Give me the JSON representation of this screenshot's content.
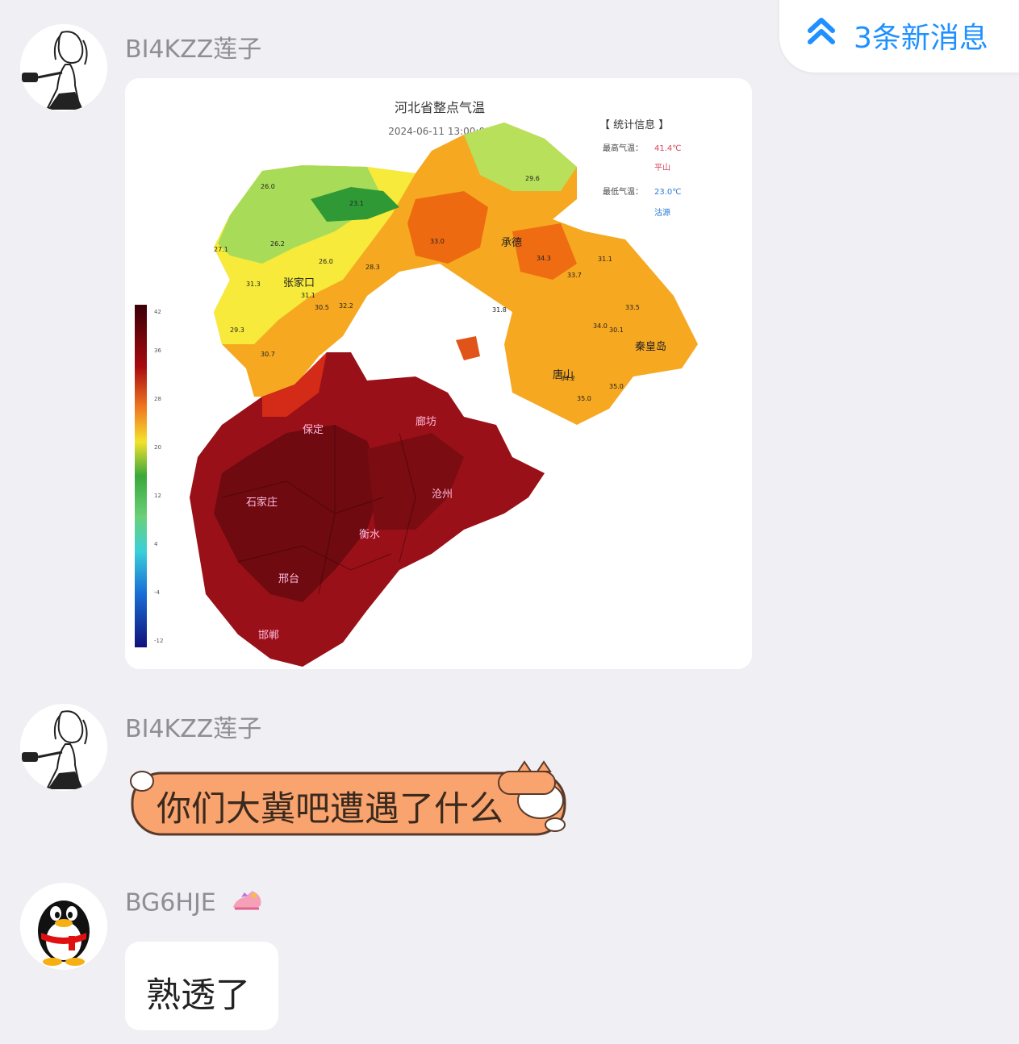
{
  "notification": {
    "new_messages_label": "3条新消息",
    "icon": "double-chevron-up-icon",
    "color": "#1e90ff"
  },
  "messages": [
    {
      "sender": "BI4KZZ莲子",
      "avatar": "anime-girl-avatar",
      "type": "image",
      "image": {
        "title": "河北省整点气温",
        "timestamp": "2024-06-11 13:00:00",
        "stats_header": "【 统计信息 】",
        "max_temp_label": "最高气温：",
        "max_temp_value": "41.4℃",
        "max_temp_place": "平山",
        "min_temp_label": "最低气温：",
        "min_temp_value": "23.0℃",
        "min_temp_place": "沽源",
        "city_labels": [
          "张家口",
          "承德",
          "秦皇岛",
          "唐山",
          "廊坊",
          "保定",
          "沧州",
          "石家庄",
          "衡水",
          "邢台",
          "邯郸"
        ],
        "temps": [
          "26.0",
          "23.1",
          "29.6",
          "27.1",
          "26.2",
          "26.0",
          "28.3",
          "31.1",
          "31.3",
          "33.0",
          "34.3",
          "30.5",
          "32.2",
          "33.7",
          "34.0",
          "31.1",
          "31.8",
          "33.5",
          "30.1",
          "34.2",
          "35.0",
          "29.3",
          "30.7",
          "35.0"
        ]
      }
    },
    {
      "sender": "BI4KZZ莲子",
      "avatar": "anime-girl-avatar",
      "type": "text",
      "bubble_style": "fox-orange",
      "text": "你们大冀吧遭遇了什么"
    },
    {
      "sender": "BG6HJE",
      "avatar": "qq-penguin-avatar",
      "badge": "shoe-badge-icon",
      "type": "text",
      "bubble_style": "white",
      "text": "熟透了"
    }
  ]
}
